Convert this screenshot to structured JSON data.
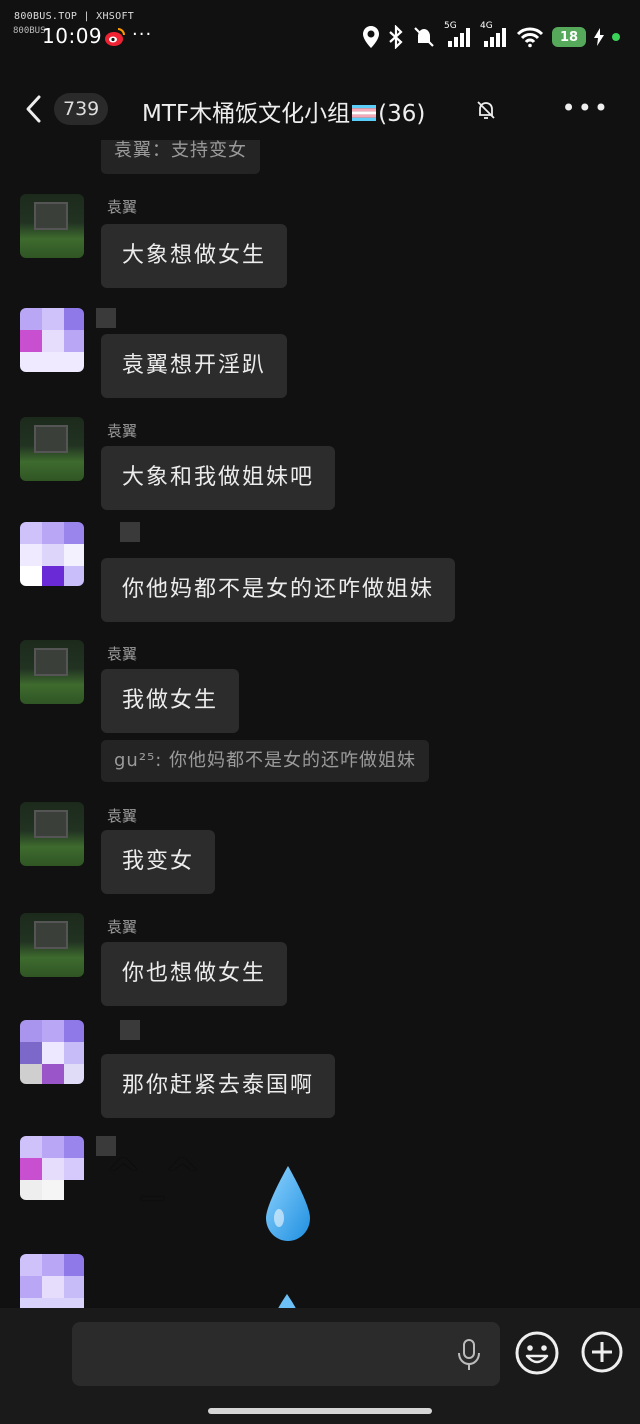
{
  "status_bar": {
    "watermark": "800BUS.TOP | XHSOFT",
    "watermark_small": "800BUS",
    "time": "10:09",
    "network_5g": "5G",
    "network_4g": "4G",
    "battery_level": "18"
  },
  "header": {
    "unread_count": "739",
    "title_prefix": "MTF木桶饭文化小组",
    "member_count_text": "(36)",
    "flag_icon": "transgender-flag-icon"
  },
  "chat": {
    "top_partial_quote": "袁翼：支持变女",
    "messages": [
      {
        "sender": "袁翼",
        "text": "大象想做女生"
      },
      {
        "sender": "",
        "text": "袁翼想开淫趴"
      },
      {
        "sender": "袁翼",
        "text": "大象和我做姐妹吧"
      },
      {
        "sender": "",
        "text": "你他妈都不是女的还咋做姐妹"
      },
      {
        "sender": "袁翼",
        "text": "我做女生",
        "quote": "gu²⁵: 你他妈都不是女的还咋做姐妹"
      },
      {
        "sender": "袁翼",
        "text": "我变女"
      },
      {
        "sender": "袁翼",
        "text": "你也想做女生"
      },
      {
        "sender": "",
        "text": "那你赶紧去泰国啊"
      }
    ],
    "sticker_text": "^_^",
    "sticker_emoji": "droplet-icon"
  },
  "input": {
    "placeholder": ""
  },
  "colors": {
    "background": "#111111",
    "bubble": "#2c2c2c",
    "battery": "#56a85a",
    "status_dot": "#3bd25a"
  }
}
